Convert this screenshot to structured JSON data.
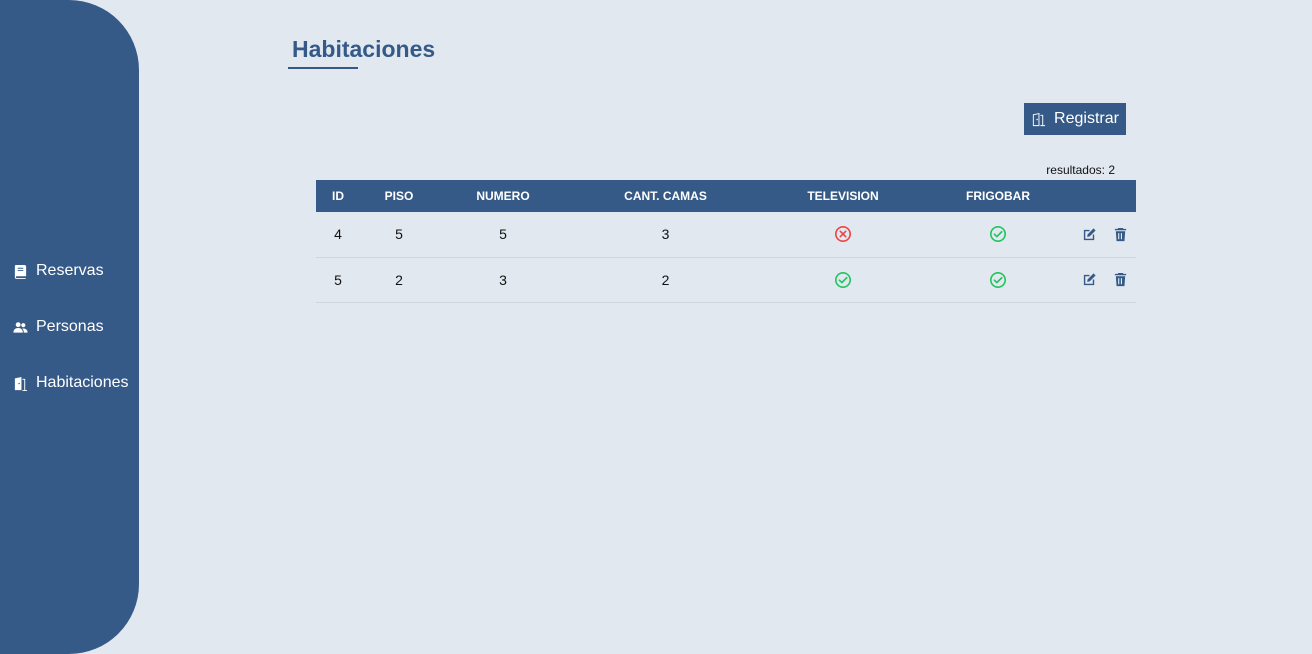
{
  "sidebar": {
    "items": [
      {
        "label": "Reservas",
        "icon": "book-icon"
      },
      {
        "label": "Personas",
        "icon": "users-icon"
      },
      {
        "label": "Habitaciones",
        "icon": "door-icon"
      }
    ]
  },
  "page": {
    "title": "Habitaciones",
    "register_label": "Registrar",
    "results_text": "resultados: 2"
  },
  "table": {
    "headers": [
      "ID",
      "PISO",
      "NUMERO",
      "CANT. CAMAS",
      "TELEVISION",
      "FRIGOBAR",
      ""
    ],
    "rows": [
      {
        "id": "4",
        "piso": "5",
        "numero": "5",
        "camas": "3",
        "television": false,
        "frigobar": true
      },
      {
        "id": "5",
        "piso": "2",
        "numero": "3",
        "camas": "2",
        "television": true,
        "frigobar": true
      }
    ]
  },
  "colors": {
    "primary": "#355a88",
    "background": "#e2e8f0",
    "yes": "#22c55e",
    "no": "#ef4444"
  }
}
